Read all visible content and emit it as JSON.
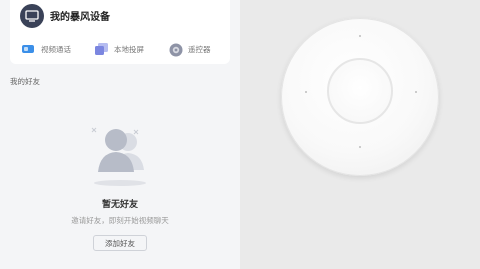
{
  "device_card": {
    "title": "我的暴风设备",
    "actions": [
      {
        "label": "视频通话",
        "icon": "video-call-icon"
      },
      {
        "label": "本地投屏",
        "icon": "local-cast-icon"
      },
      {
        "label": "遥控器",
        "icon": "remote-control-icon"
      }
    ]
  },
  "friends": {
    "section_label": "我的好友",
    "empty_title": "暂无好友",
    "empty_desc": "邀请好友，即刻开始视频聊天",
    "add_button": "添加好友"
  },
  "colors": {
    "device_icon_bg": "#3a4258",
    "video_call_icon": "#3b8fe8",
    "local_cast_icon": "#7b86e0",
    "remote_icon": "#8e93a6"
  }
}
